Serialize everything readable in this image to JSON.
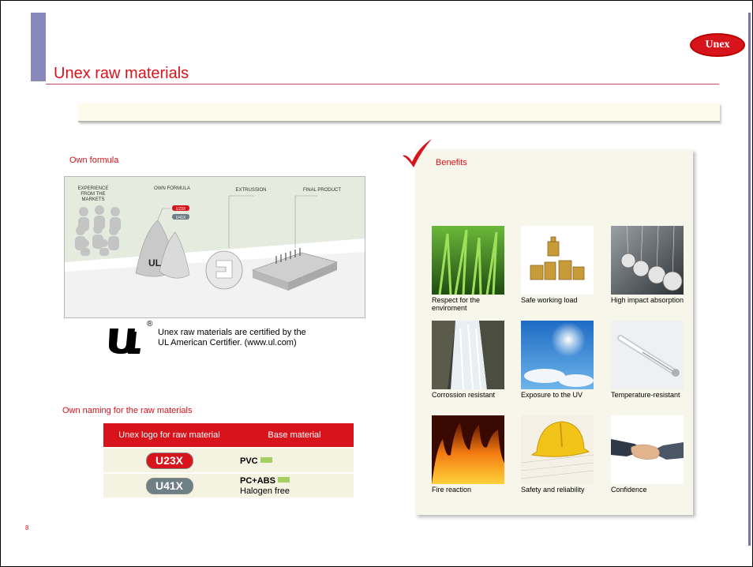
{
  "brand": {
    "logo_text": "Unex",
    "reg_mark": "®"
  },
  "page_title": "Unex raw materials",
  "own_formula": {
    "label": "Own formula",
    "diagram_labels": {
      "experience": "EXPERIENCE FROM THE MARKETS",
      "own_formula": "OWN FORMULA",
      "extrussion": "EXTRUSSION",
      "final_product": "FINAL PRODUCT"
    },
    "tags": [
      "U23X",
      "U41X"
    ]
  },
  "certification": {
    "reg_mark": "®",
    "text": "Unex raw materials are certified by the UL American Certifier. (www.ul.com)"
  },
  "naming": {
    "label": "Own naming for the raw materials",
    "headers": [
      "Unex logo for raw material",
      "Base material"
    ],
    "rows": [
      {
        "code": "U23X",
        "material": "PVC",
        "note": ""
      },
      {
        "code": "U41X",
        "material": "PC+ABS",
        "note": "Halogen free"
      }
    ]
  },
  "benefits": {
    "label": "Benefits",
    "items": [
      {
        "caption": "Respect for the enviroment",
        "icon": "grass-photo"
      },
      {
        "caption": "Safe working load",
        "icon": "weights-photo"
      },
      {
        "caption": "High impact absorption",
        "icon": "newtons-cradle-photo"
      },
      {
        "caption": "Corrossion resistant",
        "icon": "waterfall-photo"
      },
      {
        "caption": "Exposure to the UV",
        "icon": "sun-photo"
      },
      {
        "caption": "Temperature-resistant",
        "icon": "thermometer-photo"
      },
      {
        "caption": "Fire reaction",
        "icon": "fire-photo"
      },
      {
        "caption": "Safety and reliability",
        "icon": "hardhat-photo"
      },
      {
        "caption": "Confidence",
        "icon": "handshake-photo"
      }
    ]
  },
  "page_number": "8",
  "colors": {
    "accent": "#d7131c",
    "bar": "#8888bb",
    "panel": "#f7f6ea"
  }
}
